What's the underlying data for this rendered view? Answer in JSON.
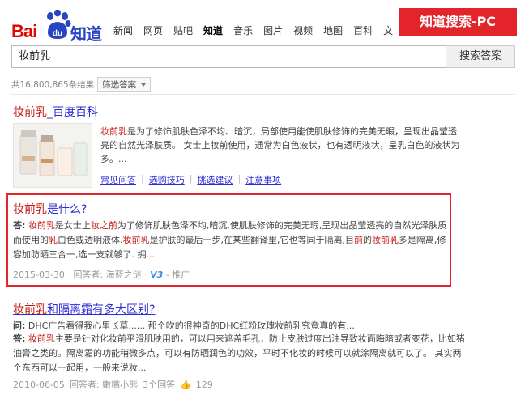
{
  "header": {
    "logo_text_bai": "Bai",
    "logo_text_du": "du",
    "logo_text_zhidao": "知道",
    "nav": [
      "新闻",
      "网页",
      "贴吧",
      "知道",
      "音乐",
      "图片",
      "视频",
      "地图",
      "百科",
      "文"
    ],
    "active_nav": "知道",
    "overlay_badge": "知道搜索-PC"
  },
  "search": {
    "query": "妆前乳",
    "button_label": "搜索答案"
  },
  "stats": {
    "result_count": "共16,800,865条结果",
    "filter_label": "筛选答案"
  },
  "results": {
    "baike": {
      "title_kw": "妆前乳",
      "title_rest": "_百度百科",
      "desc_kw": "妆前乳",
      "desc": "是为了修饰肌肤色泽不均、暗沉，局部使用能使肌肤修饰的完美无暇，呈现出晶莹透亮的自然光泽肤质。 女士上妆前使用，通常为白色液状，也有透明液状，呈乳白色的液状为多。...",
      "links": [
        "常见问答",
        "选购技巧",
        "挑选建议",
        "注意事项"
      ]
    },
    "r2": {
      "title_kw": "妆前乳",
      "title_rest": "是什么?",
      "answer_label": "答:",
      "p1_kw": "妆前乳",
      "p1": "是女士上",
      "p1_kw2": "妆之前",
      "p1_rest": "为了修饰肌肤色泽不均,暗沉,使肌肤修饰的完美无瑕,呈现出晶莹透亮的自然光泽肤质而使用的",
      "p1_kw3": "乳",
      "p1_rest2": "白色或透明液体.",
      "p1_kw4": "妆前乳",
      "p1_rest3": "是护肤的最后一步,在某些翻译里,它也等同于隔离,目",
      "p1_kw5": "前",
      "p1_rest4": "的",
      "p1_kw6": "妆前乳",
      "p1_rest5": "多是隔离,修容加防晒三合一,选一支就够了. 拥...",
      "date": "2015-03-30",
      "answerer": "回答者: 海蓝之谜",
      "tag": "V3",
      "promo": "- 推广"
    },
    "r3": {
      "title_kw": "妆前乳",
      "title_rest": "和隔离霜有多大区别?",
      "q_label": "问:",
      "q_text": "DHC广告看得我心里长草...... 那个吹的很神奇的DHC红粉玫瑰妆前乳究竟真的有...",
      "a_label": "答:",
      "a_kw": "妆前乳",
      "a_text": "主要是针对化妆前平滑肌肤用的，可以用来遮盖毛孔，防止皮肤过度出油导致妆面晦暗或者变花，比如猪油膏之类的。隔离霜的功能稍微多点，可以有防晒润色的功效，平时不化妆的时候可以就涂隔离就可以了。 其实两个东西可以一起用，一般来说妆...",
      "date": "2010-06-05",
      "answerer": "回答者: 嫩嘴小熊",
      "answers": "3个回答",
      "likes": "129"
    }
  },
  "colors": {
    "brand_red": "#e10602",
    "brand_blue": "#2745c2",
    "badge_red": "#e3242b",
    "link_blue": "#2b2bd8",
    "keyword_red": "#c41a16"
  }
}
